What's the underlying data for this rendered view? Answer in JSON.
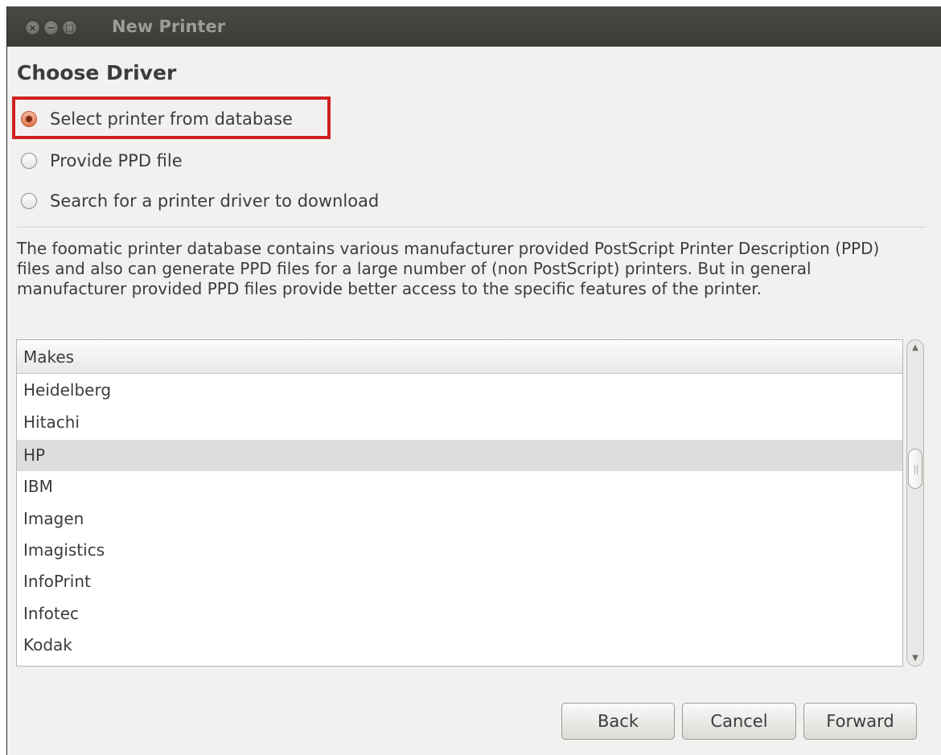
{
  "window": {
    "title": "New Printer"
  },
  "page": {
    "heading": "Choose Driver"
  },
  "options": [
    {
      "label": "Select printer from database",
      "checked": true
    },
    {
      "label": "Provide PPD file",
      "checked": false
    },
    {
      "label": "Search for a printer driver to download",
      "checked": false
    }
  ],
  "description": "The foomatic printer database contains various manufacturer provided PostScript Printer Description (PPD) files and also can generate PPD files for a large number of (non PostScript) printers. But in general manufacturer provided PPD files provide better access to the specific features of the printer.",
  "makes": {
    "header": "Makes",
    "items": [
      "Heidelberg",
      "Hitachi",
      "HP",
      "IBM",
      "Imagen",
      "Imagistics",
      "InfoPrint",
      "Infotec",
      "Kodak"
    ],
    "selected": "HP"
  },
  "buttons": {
    "back": "Back",
    "cancel": "Cancel",
    "forward": "Forward"
  },
  "colors": {
    "highlight_box": "#d01f1f",
    "radio_accent": "#e0774f",
    "titlebar": "#3b3a37"
  }
}
